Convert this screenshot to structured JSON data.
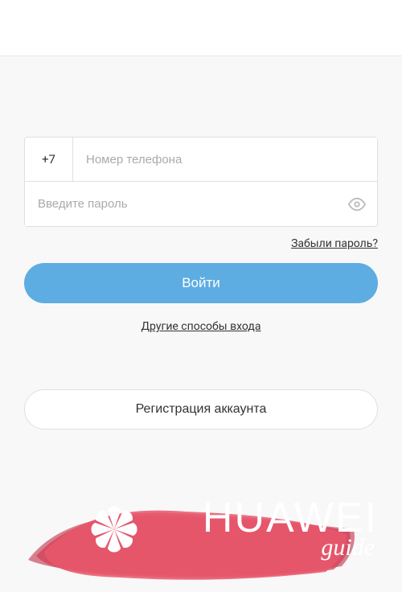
{
  "phone": {
    "country_code": "+7",
    "placeholder": "Номер телефона",
    "value": ""
  },
  "password": {
    "placeholder": "Введите пароль",
    "value": ""
  },
  "links": {
    "forgot": "Забыли пароль?",
    "other_methods": "Другие способы входа"
  },
  "buttons": {
    "login": "Войти",
    "register": "Регистрация аккаунта"
  },
  "branding": {
    "name": "HUAWEI",
    "subtitle": "guide"
  }
}
